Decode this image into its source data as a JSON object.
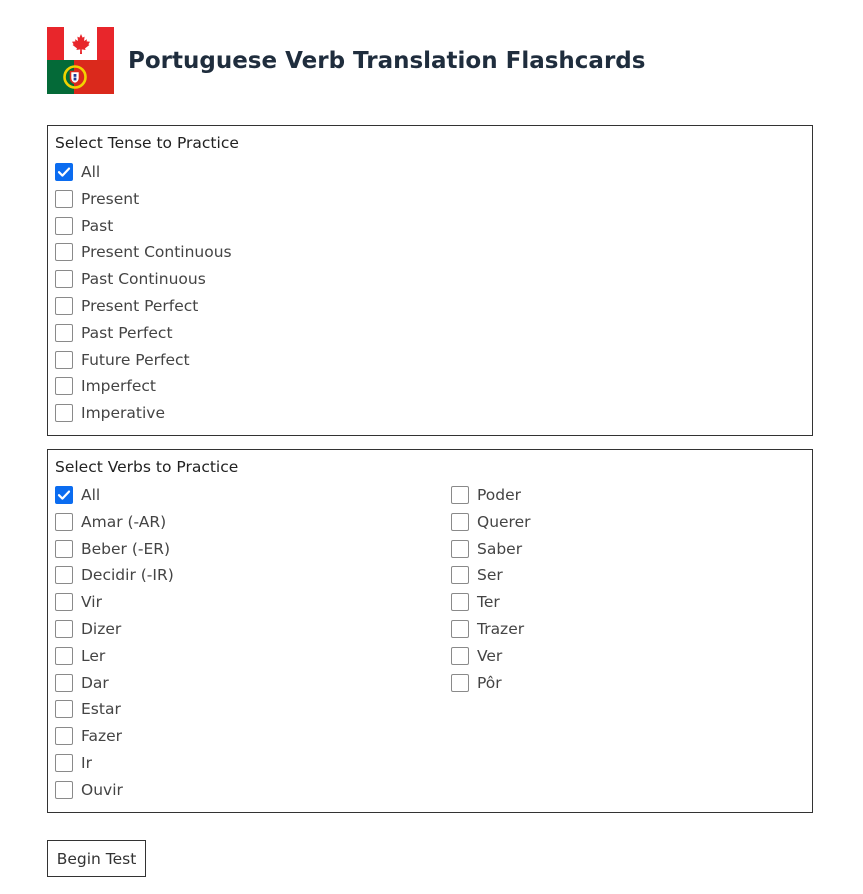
{
  "header": {
    "title": "Portuguese Verb Translation Flashcards"
  },
  "tense_panel": {
    "legend": "Select Tense to Practice",
    "options": [
      {
        "label": "All",
        "checked": true
      },
      {
        "label": "Present",
        "checked": false
      },
      {
        "label": "Past",
        "checked": false
      },
      {
        "label": "Present Continuous",
        "checked": false
      },
      {
        "label": "Past Continuous",
        "checked": false
      },
      {
        "label": "Present Perfect",
        "checked": false
      },
      {
        "label": "Past Perfect",
        "checked": false
      },
      {
        "label": "Future Perfect",
        "checked": false
      },
      {
        "label": "Imperfect",
        "checked": false
      },
      {
        "label": "Imperative",
        "checked": false
      }
    ]
  },
  "verbs_panel": {
    "legend": "Select Verbs to Practice",
    "column1": [
      {
        "label": "All",
        "checked": true
      },
      {
        "label": "Amar (-AR)",
        "checked": false
      },
      {
        "label": "Beber (-ER)",
        "checked": false
      },
      {
        "label": "Decidir (-IR)",
        "checked": false
      },
      {
        "label": "Vir",
        "checked": false
      },
      {
        "label": "Dizer",
        "checked": false
      },
      {
        "label": "Ler",
        "checked": false
      },
      {
        "label": "Dar",
        "checked": false
      },
      {
        "label": "Estar",
        "checked": false
      },
      {
        "label": "Fazer",
        "checked": false
      },
      {
        "label": "Ir",
        "checked": false
      },
      {
        "label": "Ouvir",
        "checked": false
      }
    ],
    "column2": [
      {
        "label": "Poder",
        "checked": false
      },
      {
        "label": "Querer",
        "checked": false
      },
      {
        "label": "Saber",
        "checked": false
      },
      {
        "label": "Ser",
        "checked": false
      },
      {
        "label": "Ter",
        "checked": false
      },
      {
        "label": "Trazer",
        "checked": false
      },
      {
        "label": "Ver",
        "checked": false
      },
      {
        "label": "Pôr",
        "checked": false
      }
    ]
  },
  "actions": {
    "begin_label": "Begin Test"
  },
  "colors": {
    "accent": "#0b6cf0",
    "title": "#1f2d3d",
    "canada_red": "#e8262b",
    "portugal_green": "#046a38",
    "portugal_red": "#da291c"
  }
}
